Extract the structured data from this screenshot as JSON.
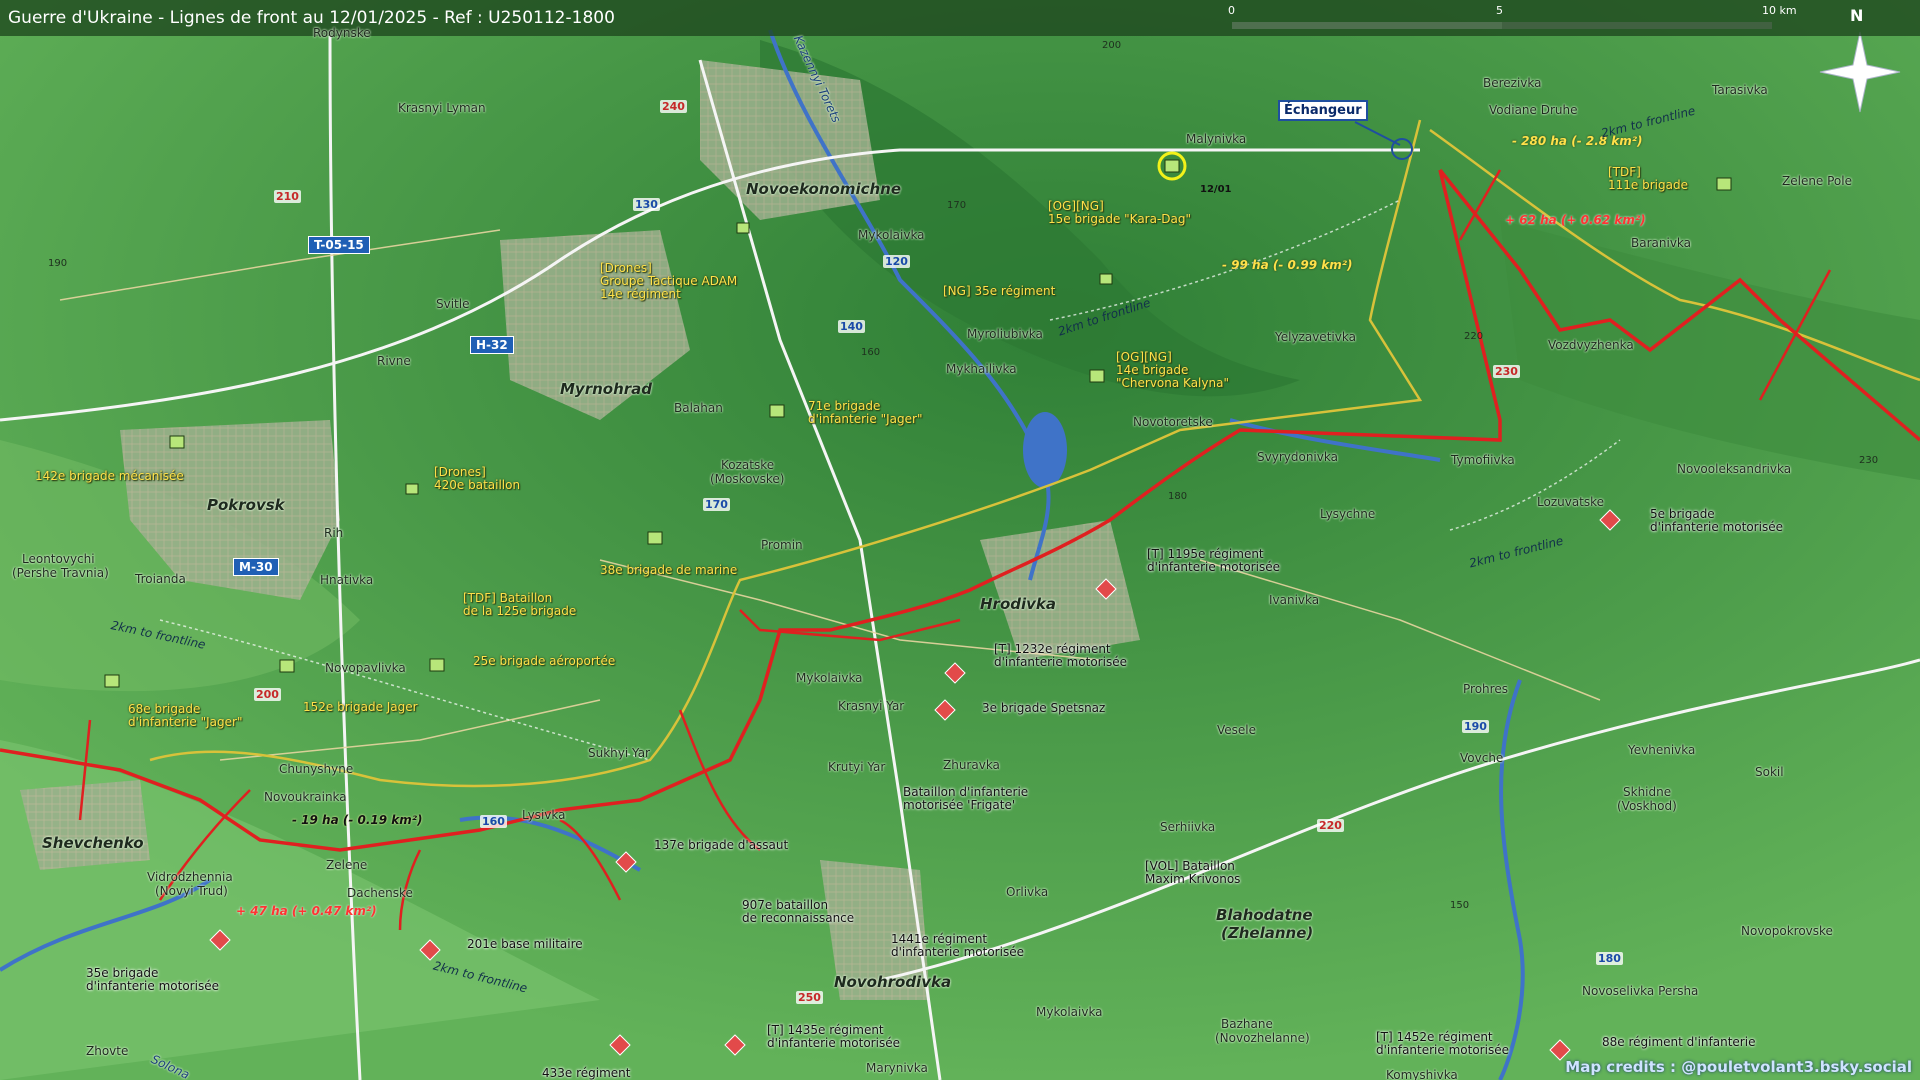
{
  "header": {
    "title": "Guerre d'Ukraine - Lignes de front au 12/01/2025 - Ref : U250112-1800",
    "scale": [
      "0",
      "5",
      "10 km"
    ],
    "north": "N"
  },
  "credits": "Map credits : @pouletvolant3.bsky.social",
  "callout": {
    "label": "Échangeur",
    "date_tag": "12/01"
  },
  "colors": {
    "terrain_low": "#62b259",
    "terrain_high": "#2f7f36",
    "water": "#3f73c8",
    "front_line": "#e02020",
    "old_line": "#d8c23a",
    "ua_label": "#ffe14a",
    "ru_marker": "#e24a4a"
  },
  "places": {
    "major": [
      "Pokrovsk",
      "Myrnohrad",
      "Novoekonomichne",
      "Hrodivka",
      "Novohrodivka",
      "Shevchenko",
      "Blahodatne",
      "(Zhelanne)"
    ],
    "minor": [
      "Rodynske",
      "Krasnyi Lyman",
      "Svitle",
      "Rivne",
      "Mykolaivka",
      "Malynivka",
      "Berezivka",
      "Vodiane Druhe",
      "Tarasivka",
      "Zelene Pole",
      "Baranivka",
      "Myroliubivka",
      "Mykhailivka",
      "Yelyzavetivka",
      "Vozdvyzhenka",
      "Novotoretske",
      "Svyrydonivka",
      "Tymofiivka",
      "Novooleksandrivka",
      "Lozuvatske",
      "Lysychne",
      "Ivanivka",
      "Balahan",
      "Kozatske",
      "(Moskovske)",
      "Promin",
      "Rih",
      "Hnativka",
      "Leontovychi",
      "(Pershe Travnia)",
      "Troianda",
      "Novopavlivka",
      "Mykolaivka",
      "Krasnyi Yar",
      "Krutyi Yar",
      "Zhuravka",
      "Sukhyi Yar",
      "Chunyshyne",
      "Novoukrainka",
      "Lysivka",
      "Zelene",
      "Vidrodzhennia",
      "(Novyi Trud)",
      "Dachenske",
      "Veselе",
      "Serhiivka",
      "Orlivka",
      "Mykolaivka",
      "Bazhane",
      "(Novozhelanne)",
      "Zhovte",
      "Marynivka",
      "Komyshivka",
      "Prohres",
      "Vovche",
      "Yevhenivka",
      "Sokil",
      "Skhidne",
      "(Voskhod)",
      "Novopokrovske",
      "Novoselivka Persha",
      "Kazennyi Torets",
      "Solona"
    ]
  },
  "roads": [
    "T-05-15",
    "H-32",
    "M-30"
  ],
  "road_numbers": [
    "240",
    "210",
    "130",
    "120",
    "140",
    "160",
    "170",
    "200",
    "230",
    "250",
    "190",
    "180",
    "220"
  ],
  "elevations": [
    "200",
    "190",
    "170",
    "180",
    "160",
    "150",
    "220",
    "230"
  ],
  "ua_units": [
    "[Drones]",
    "Groupe Tactique ADAM",
    "14e régiment",
    "142e brigade mécanisée",
    "[Drones]",
    "420e bataillon",
    "[TDF] Bataillon",
    "de la 125e brigade",
    "38e brigade de marine",
    "71e brigade",
    "d'infanterie \"Jager\"",
    "[NG] 35e régiment",
    "[OG][NG]",
    "15e brigade \"Kara-Dag\"",
    "[OG][NG]",
    "14e brigade",
    "\"Chervona Kalyna\"",
    "[TDF]",
    "111e brigade",
    "25e brigade aéroportée",
    "152e brigade Jager",
    "68e brigade",
    "d'infanterie \"Jager\""
  ],
  "ru_units": [
    "[T] 1195e régiment",
    "d'infanterie motorisée",
    "5e brigade",
    "d'infanterie motorisée",
    "[T] 1232e régiment",
    "d'infanterie motorisée",
    "3e brigade Spetsnaz",
    "Bataillon d'infanterie",
    "motorisée 'Frigate'",
    "[VOL] Bataillon",
    "Maxim Krivonos",
    "137e brigade d'assaut",
    "907e bataillon",
    "de reconnaissance",
    "1441e régiment",
    "d'infanterie motorisée",
    "201e base militaire",
    "35e brigade",
    "d'infanterie motorisée",
    "[T] 1435e régiment",
    "d'infanterie motorisée",
    "433e régiment",
    "[T] 1452e régiment",
    "d'infanterie motorisée",
    "88e régiment d'infanterie"
  ],
  "deltas": [
    "- 280 ha (- 2.8 km²)",
    "+ 62 ha (+ 0.62 km²)",
    "- 99 ha (- 0.99 km²)",
    "- 19 ha (- 0.19 km²)",
    "+ 47 ha (+ 0.47 km²)"
  ],
  "frontline_label": "2km to frontline"
}
